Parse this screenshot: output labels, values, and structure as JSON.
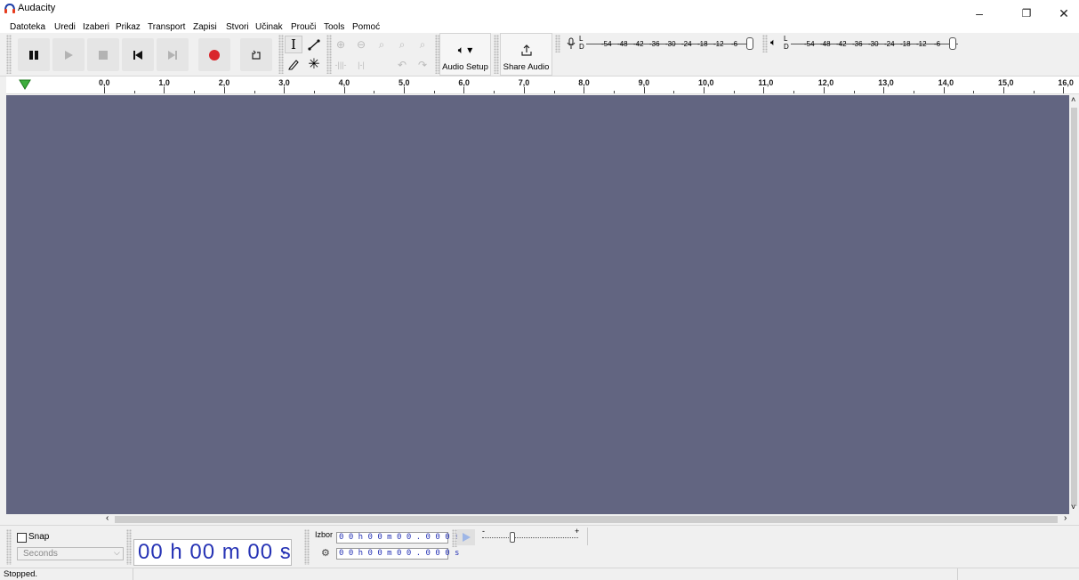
{
  "window": {
    "title": "Audacity",
    "minimize": "–",
    "restore": "❐",
    "close": "✕"
  },
  "menu": [
    "Datoteka",
    "Uredi",
    "Izaberi",
    "Prikaz",
    "Transport",
    "Zapisi",
    "Stvori",
    "Učinak",
    "Prouči",
    "Tools",
    "Pomoć"
  ],
  "toolbar": {
    "audio_setup_label": "Audio Setup",
    "share_audio_label": "Share Audio",
    "rec_meter_channels": [
      "L",
      "D"
    ],
    "play_meter_channels": [
      "L",
      "D"
    ],
    "meter_ticks": [
      "-54",
      "-48",
      "-42",
      "-36",
      "-30",
      "-24",
      "-18",
      "-12",
      "-6"
    ]
  },
  "ruler": {
    "labels": [
      "0,0",
      "1,0",
      "2,0",
      "3,0",
      "4,0",
      "5,0",
      "6,0",
      "7,0",
      "8,0",
      "9,0",
      "10,0",
      "11,0",
      "12,0",
      "13,0",
      "14,0",
      "15,0",
      "16,0"
    ]
  },
  "colors": {
    "track_bg": "#626581",
    "time_text": "#2633b5",
    "record_red": "#d9262b",
    "play_green": "#3dad3d"
  },
  "snap": {
    "label": "Snap",
    "unit": "Seconds",
    "checked": false
  },
  "time_display": {
    "value": "00 h 00 m 00 s"
  },
  "selection": {
    "label": "Izbor",
    "start": "0 0 h 0 0 m 0 0 . 0 0 0 s",
    "end": "0 0 h 0 0 m 0 0 . 0 0 0 s"
  },
  "play_speed": {
    "minus": "-",
    "plus": "+"
  },
  "status": {
    "text": "Stopped."
  }
}
